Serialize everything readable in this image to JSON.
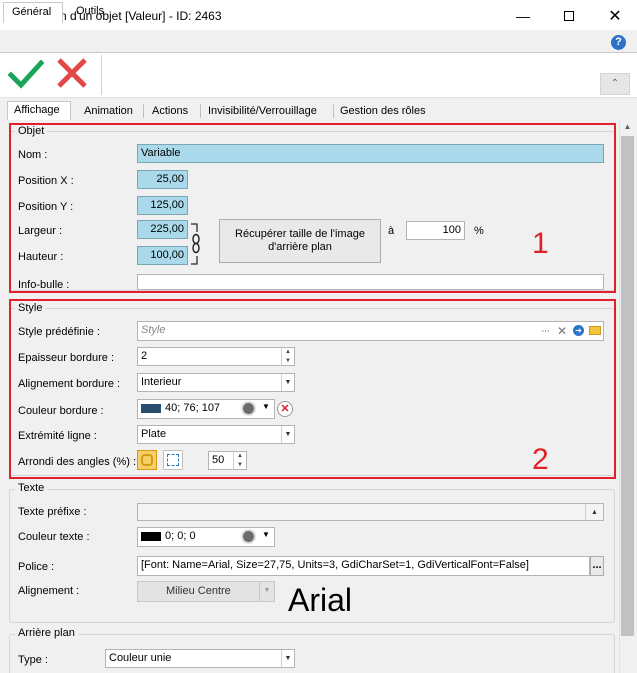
{
  "window": {
    "title": "Edition d'un objet [Valeur] - ID: 2463",
    "minimize_icon": "minimize-icon",
    "maximize_icon": "maximize-icon",
    "close_icon": "close-icon"
  },
  "top_tabs": [
    {
      "label": "Général"
    },
    {
      "label": "Outils"
    }
  ],
  "toolbar": {
    "validate_icon": "check-icon",
    "cancel_icon": "cross-icon"
  },
  "sub_tabs": [
    {
      "label": "Affichage"
    },
    {
      "label": "Animation"
    },
    {
      "label": "Actions"
    },
    {
      "label": "Invisibilité/Verrouillage"
    },
    {
      "label": "Gestion des rôles"
    }
  ],
  "objet": {
    "title": "Objet",
    "nom_label": "Nom :",
    "nom_value": "Variable",
    "posx_label": "Position X :",
    "posx_value": "25,00",
    "posy_label": "Position Y :",
    "posy_value": "125,00",
    "largeur_label": "Largeur :",
    "largeur_value": "225,00",
    "hauteur_label": "Hauteur :",
    "hauteur_value": "100,00",
    "recup_button": "Récupérer taille de l'image d'arrière plan",
    "a_label": "à",
    "pct_value": "100",
    "pct_unit": "%",
    "infobulle_label": "Info-bulle :",
    "infobulle_value": "",
    "annotation": "1"
  },
  "style": {
    "title": "Style",
    "predef_label": "Style prédéfinie :",
    "predef_placeholder": "Style",
    "epaisseur_label": "Epaisseur bordure :",
    "epaisseur_value": "2",
    "alignement_label": "Alignement bordure :",
    "alignement_value": "Interieur",
    "couleur_label": "Couleur bordure :",
    "couleur_value": "40; 76; 107",
    "couleur_swatch": "#284c6b",
    "extremite_label": "Extrémité ligne :",
    "extremite_value": "Plate",
    "arrondi_label": "Arrondi des angles (%) :",
    "arrondi_value": "50",
    "annotation": "2"
  },
  "texte": {
    "title": "Texte",
    "prefixe_label": "Texte préfixe :",
    "prefixe_value": "",
    "couleur_label": "Couleur texte :",
    "couleur_value": "0; 0; 0",
    "couleur_swatch": "#000000",
    "police_label": "Police :",
    "police_value": "[Font: Name=Arial, Size=27,75, Units=3, GdiCharSet=1, GdiVerticalFont=False]",
    "police_button": "...",
    "alignement_label": "Alignement :",
    "alignement_value": "Milieu Centre",
    "font_preview": "Arial"
  },
  "arriere_plan": {
    "title": "Arrière plan",
    "type_label": "Type :",
    "type_value": "Couleur unie"
  },
  "colors": {
    "accent_red": "#e0202a",
    "field_blue": "#a9d9ea",
    "check_green": "#1aa55a"
  }
}
